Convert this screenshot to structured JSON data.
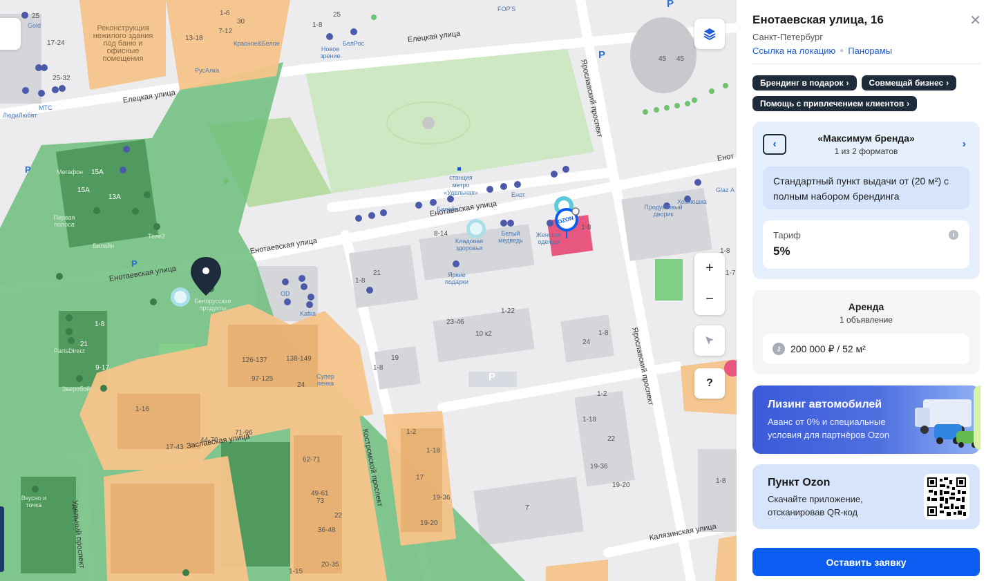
{
  "panel": {
    "title": "Енотаевская улица, 16",
    "city": "Санкт-Петербург",
    "link_location": "Ссылка на локацию",
    "link_panoramas": "Панорамы",
    "close_icon": "close-icon",
    "chips": [
      "Брендинг в подарок",
      "Совмещай бизнес",
      "Помощь с привлечением клиентов"
    ],
    "format": {
      "title": "«Максимум бренда»",
      "subtitle": "1 из 2 форматов",
      "description": "Стандартный пункт выдачи от (20 м²) с полным набором брендинга",
      "tariff_label": "Тариф",
      "tariff_value": "5%"
    },
    "rent": {
      "title": "Аренда",
      "subtitle": "1 объявление",
      "item": "200 000 ₽ / 52 м²"
    },
    "leasing": {
      "title": "Лизинг автомобилей",
      "text": "Аванс от 0% и специальные условия для партнёров Ozon"
    },
    "ozon": {
      "title": "Пункт Ozon",
      "text": "Скачайте приложение, отсканировав QR-код"
    },
    "submit_label": "Оставить заявку"
  },
  "map": {
    "controls": {
      "layers_icon": "layers-icon",
      "zoom_in": "+",
      "zoom_out": "−",
      "locate_icon": "locate-arrow-icon",
      "help": "?"
    },
    "streets": {
      "s1": "Елецкая улица",
      "s2": "Елецкая улица",
      "s3": "Енотаевская улица",
      "s4": "Енотаевская улица",
      "s5": "Енотаевская улица",
      "s6": "Заславская улица",
      "s7": "Костромской проспект",
      "s8": "Удельный проспект",
      "s9": "Ярославский проспект",
      "s10": "Ярославский проспект",
      "s11": "Калязинская улица",
      "s12": "Енот"
    },
    "labels": {
      "building_text": "Реконструкция нежилого здания под баню и офисные помещения",
      "metro": "станция метро «Удельная»",
      "b1": "25",
      "b2": "17-24",
      "b3": "25-32",
      "b4": "1-6",
      "b5": "30",
      "b6": "7-12",
      "b7": "13-18",
      "b8": "25",
      "b9": "1-8",
      "b10": "15А",
      "b11": "15А",
      "b12": "13А",
      "b13": "8-14",
      "b14": "1-8",
      "b15": "21",
      "b16": "1-8",
      "b17": "21",
      "b18": "9-17",
      "b19": "126-137",
      "b20": "138-149",
      "b21": "97-125",
      "b22": "24",
      "b23": "1-16",
      "b24": "71-96",
      "b25": "44-70",
      "b26": "17-43",
      "b27": "62-71",
      "b28": "49-61",
      "b29": "73",
      "b30": "22",
      "b31": "36-48",
      "b32": "20-35",
      "b33": "1-15",
      "b34": "1-22",
      "b35": "23-46",
      "b36": "10 к2",
      "b37": "19",
      "b38": "1-8",
      "b39": "1-8",
      "b40": "24",
      "b41": "1-2",
      "b42": "1-18",
      "b43": "17",
      "b44": "19-36",
      "b45": "19-20",
      "b46": "1-2",
      "b47": "1-18",
      "b48": "22",
      "b49": "19-36",
      "b50": "19-20",
      "b51": "7",
      "b52": "1-8",
      "b53": "45",
      "b54": "45",
      "b55": "1-8",
      "b56": "1-8",
      "b57": "1-7"
    },
    "pois": {
      "p1": "МТС",
      "p2": "ЛюдиЛюбят",
      "p3": "Новое зрение",
      "p4": "БелРос",
      "p5": "FOP'S",
      "p6": "Красное&Белое",
      "p7": "РусАлка",
      "p8": "Мегафон",
      "p9": "Первая полоса",
      "p10": "Теле2",
      "p11": "Билайн",
      "p12": "Белорусские продукты",
      "p13": "PartsDirect",
      "p14": "Зверобой",
      "p15": "Билайн",
      "p16": "Кладовая здоровья",
      "p17": "Белый медведь",
      "p18": "Яркие подарки",
      "p19": "Женская одежда",
      "p20": "Енот",
      "p21": "Продуктовый дворик",
      "p22": "Хозяюшка",
      "p23": "Glaz А",
      "p24": "OD",
      "p25": "Katka",
      "p26": "Супер пенка",
      "p27": "Вкусно и точка",
      "p28": "Gold"
    },
    "badge": "OZON",
    "parking": "P"
  },
  "colors": {
    "accent": "#0b5cf0",
    "chip": "#1d2b3a",
    "green_zone": "#6dbd7c",
    "orange_zone": "#f5c48a",
    "ozon_pink": "#e7577f",
    "marker_teal": "#5ec9d8"
  }
}
